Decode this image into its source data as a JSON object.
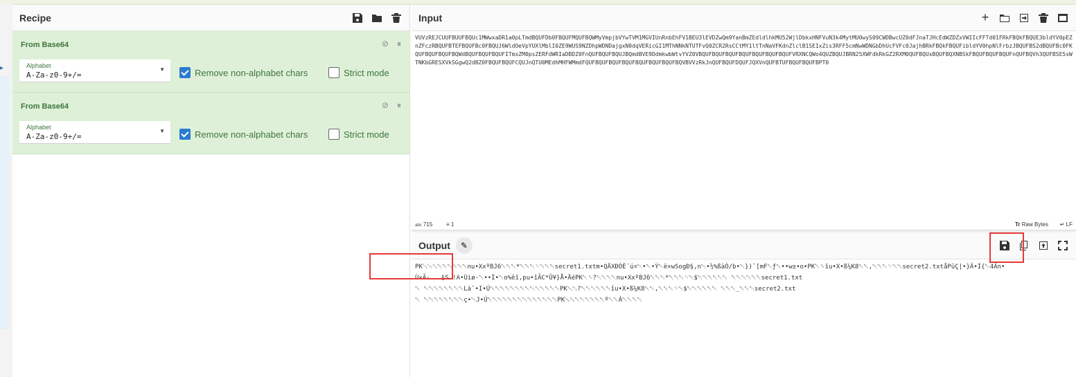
{
  "recipe": {
    "title": "Recipe",
    "operations": [
      {
        "name": "From Base64",
        "alphabet_label": "Alphabet",
        "alphabet_value": "A-Za-z0-9+/=",
        "remove_label": "Remove non-alphabet chars",
        "remove_checked": true,
        "strict_label": "Strict mode",
        "strict_checked": false
      },
      {
        "name": "From Base64",
        "alphabet_label": "Alphabet",
        "alphabet_value": "A-Za-z0-9+/=",
        "remove_label": "Remove non-alphabet chars",
        "remove_checked": true,
        "strict_label": "Strict mode",
        "strict_checked": false
      }
    ]
  },
  "input": {
    "title": "Input",
    "text": "VUVzREJCUUFBUUFBQUc1MWwxaDR1a0pLTmdBQUFDb0FBQUFMQUFBQWMyVmpjbVYwTVM1MGVIUnRnbEhFV1BEU3lEVDZwQm9YanBmZEdldlhkMU52WjlDbkxHNFVuN3k4MytMU0wyS09CWDBwcUZ0dFJnaTJHcEdWZDZxVWIIcFFTd01FRkFBQkFBQUE3bldYV0pEZnZFczRBQUFBTEFBQUFBc0FBQUJ6WldOeVpYUXlMblI0ZE9WUS9NZDhpWDNDajgxN0dqVERicGI1MThNNkNTUTFvQ0ZCR2RsCCtMY1ltTnNaVFKdnZlclB1SEIxZis3RFF5cmNwWDNGbDhUcFVFc0JajhBRkFBQkFBQUFibldYV0hpNlFrbzJBQUFBS2dBQUFBc0FKQUFBQUFBQUFBQWdBQUFBQUFBQUFITmxZM0psZERFdWRIaDBDZ0FnQUFBQUFBQUJBQmdBVE9DdmkwbWtvYVZ0VBQUFBQUFBQUFBQUFBQUFBQUFBQUFVRXNCQWo4QUZBQUJBRN25XWFdkRkGZ2RXM0QUFBQUxBQUFBQXNBSkFBQUFBQUFBQUFnQUFBQVh3QUFBSE5sWTNKbGRESXVkSGgwQ2dBZ0FBQUFBQUFCQUJnQTU0MEdhMHFWMmdFQUFBQUFBQUFBQUFBQUFBQUFBQUFBQVBVVzRkJnQUFBQUFDQUFJQXVnQUFBTUFBQUFBQUFBPT0",
    "stats_chars": "715",
    "stats_lines": "1",
    "stats_raw": "Raw Bytes",
    "stats_eol": "LF"
  },
  "output": {
    "title": "Output",
    "lines": [
      "PK␃␄␔␀␀␀␈␀␀nu•XxºBJ6␀␀␀*␀␀␀␋␀␀␀secret1.txtm•QÄXÐÒÈ´ú¤␀•␀•Ý␀ë×wSogÐ§,n␀•½%ßàÒ/b•␀})¯[mF␀ƒ␀••w±•o•PK␇␈îu•X•ß¼K8␀␀,␀␀␀␋␀␀secret2.txtåPüÇ|•}Â•Í{␀4Ãn•",
      "Ù×Ã·   §S !A•Ùiø·␀••Ì•␀o%êî,pu•îÃC*Ü¥}Å•ÄéPK␇␈?␀␀␀␀nu•XxºBJ6␀␀␀*␀␀␀␋␀$␀␀␀␀␀␀ ␀␀␀␀␀␀secret1.txt",
      "␀ ␀␀␀␀␀␀␀␀Là¯•I•Ú␀␀␀␀␀␀␀␀␀␀␀␀␀␀PK␁␂?␀␀␀␀␀␀îu•X•ß¼K8␀␀,␀␀␀␋␀$␀␀␀␀␀␀ ␀␀␀_␀␀␀secret2.txt",
      "␀ ␀␀␀␀␀␀␀␀ç•␀J•Ú␀␀␀␀␀␀␀␀␀␀␀␀␀␀PK␅␆␀␀␀␀␀␀º␀␀À␀␀␀␀"
    ]
  },
  "annotations": {
    "box_color": "#e53935"
  }
}
